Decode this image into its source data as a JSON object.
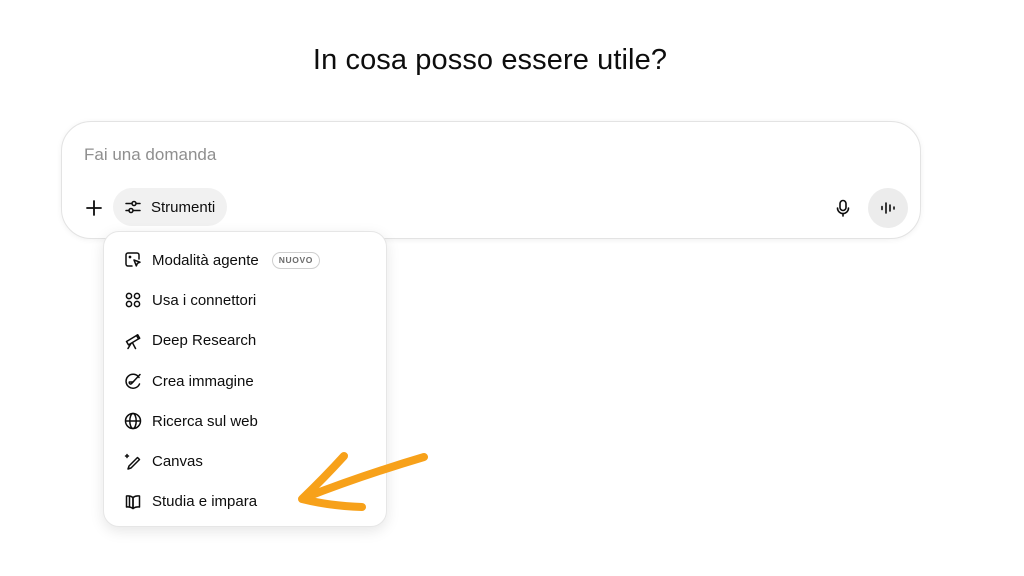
{
  "heading": "In cosa posso essere utile?",
  "composer": {
    "placeholder": "Fai una domanda",
    "value": "",
    "plus_icon": "plus-icon",
    "tools_label": "Strumenti",
    "tools_icon": "sliders-icon",
    "mic_icon": "microphone-icon",
    "voice_icon": "voice-mode-icon"
  },
  "tools_menu": {
    "items": [
      {
        "label": "Modalità agente",
        "icon": "agent-cursor-icon",
        "badge": "NUOVO"
      },
      {
        "label": "Usa i connettori",
        "icon": "connectors-icon"
      },
      {
        "label": "Deep Research",
        "icon": "telescope-icon"
      },
      {
        "label": "Crea immagine",
        "icon": "image-palette-icon"
      },
      {
        "label": "Ricerca sul web",
        "icon": "globe-icon"
      },
      {
        "label": "Canvas",
        "icon": "pencil-sparkle-icon"
      },
      {
        "label": "Studia e impara",
        "icon": "book-icon"
      }
    ]
  },
  "annotation": {
    "icon": "orange-arrow-icon",
    "color": "#f7a11a"
  },
  "colors": {
    "tools_bg": "#f1f1f1",
    "voice_bg": "#ececec",
    "border": "#e3e3e3"
  }
}
